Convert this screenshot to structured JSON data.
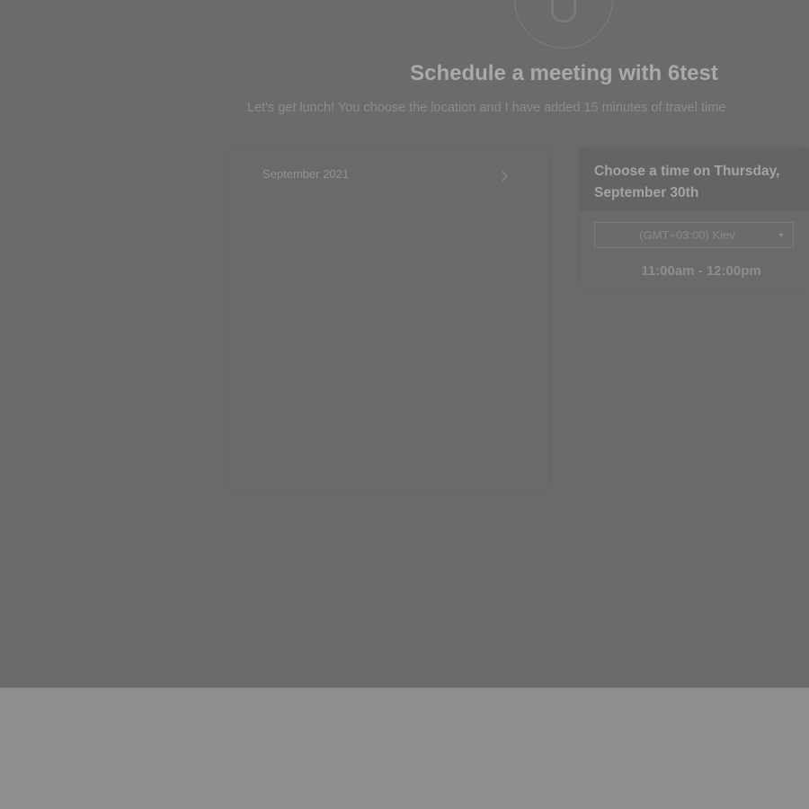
{
  "header": {
    "title": "Schedule a meeting with 6test",
    "subtitle": "Let's get lunch! You choose the location and I have added 15 minutes of travel time"
  },
  "calendar": {
    "month_label": "September 2021"
  },
  "time_panel": {
    "title": "Choose a time on Thursday, September 30th",
    "timezone": {
      "selected": "(GMT+03:00) Kiev"
    },
    "slots": [
      "11:00am - 12:00pm"
    ]
  },
  "icons": {
    "avatar": "user-avatar-icon",
    "next": "chevron-right-icon",
    "dropdown": "caret-down-icon"
  },
  "colors": {
    "overlay": "#6b6b6b",
    "lower_area": "#8e8e8e",
    "title_text": "#a9a9a9"
  }
}
